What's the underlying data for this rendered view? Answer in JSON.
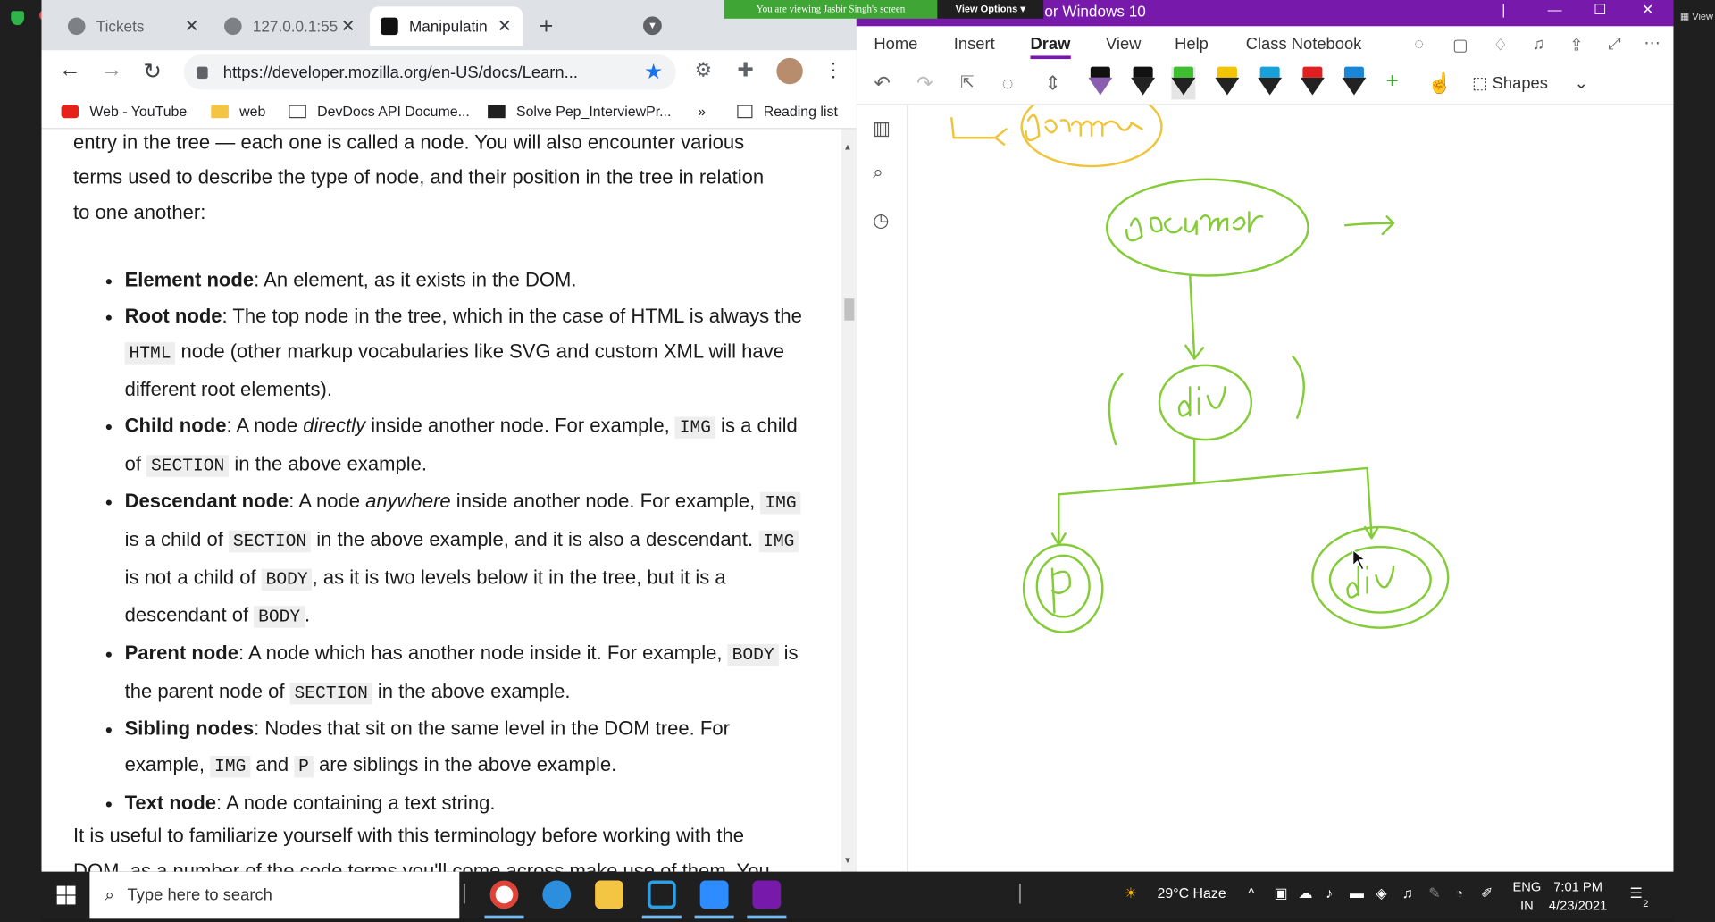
{
  "browser": {
    "tabs": [
      {
        "label": "Tickets"
      },
      {
        "label": "127.0.0.1:55"
      },
      {
        "label": "Manipulatin"
      }
    ],
    "url": "https://developer.mozilla.org/en-US/docs/Learn...",
    "bookmarks": [
      {
        "label": "Web - YouTube"
      },
      {
        "label": "web"
      },
      {
        "label": "DevDocs API Docume..."
      },
      {
        "label": "Solve Pep_InterviewPr..."
      }
    ],
    "bookmarks_overflow": "»",
    "reading_list": "Reading list"
  },
  "article": {
    "intro_lines": [
      "entry in the tree — each one is called a node. You will also encounter various",
      "terms used to describe the type of node, and their position in the tree in relation",
      "to one another:"
    ],
    "items": [
      {
        "term": "Element node",
        "rest": ": An element, as it exists in the DOM."
      },
      {
        "term": "Root node",
        "a": ": The top node in the tree, which in the case of HTML is always the ",
        "code1": "HTML",
        "b": " node (other markup vocabularies like SVG and custom XML will have different root elements)."
      },
      {
        "term": "Child node",
        "a": ": A node ",
        "em": "directly",
        "b": " inside another node. For example, ",
        "code1": "IMG",
        "c": " is a child of ",
        "code2": "SECTION",
        "d": " in the above example."
      },
      {
        "term": "Descendant node",
        "a": ": A node ",
        "em": "anywhere",
        "b": " inside another node. For example, ",
        "code1": "IMG",
        "c": " is a child of ",
        "code2": "SECTION",
        "d": " in the above example, and it is also a descendant. ",
        "code3": "IMG",
        "e": " is not a child of ",
        "code4": "BODY",
        "f": ", as it is two levels below it in the tree, but it is a descendant of ",
        "code5": "BODY",
        "g": "."
      },
      {
        "term": "Parent node",
        "a": ": A node which has another node inside it. For example, ",
        "code1": "BODY",
        "b": " is the parent node of ",
        "code2": "SECTION",
        "c": " in the above example."
      },
      {
        "term": "Sibling nodes",
        "a": ": Nodes that sit on the same level in the DOM tree. For example, ",
        "code1": "IMG",
        "b": " and ",
        "code2": "P",
        "c": " are siblings in the above example."
      },
      {
        "term": "Text node",
        "rest": ": A node containing a text string."
      }
    ],
    "outro_lines": [
      "It is useful to familiarize yourself with this terminology before working with the",
      "DOM, as a number of the code terms you'll come across make use of them. You"
    ]
  },
  "onenote": {
    "title": "or Windows 10",
    "menu": [
      "Home",
      "Insert",
      "Draw",
      "View",
      "Help",
      "Class Notebook"
    ],
    "active_menu": "Draw",
    "shapes_label": "Shapes",
    "pen_colors": [
      "#111111",
      "#111111",
      "#3fbf2f",
      "#f2c500",
      "#18a0d8",
      "#e02020",
      "#1a86d8"
    ],
    "ink_color": "#84cc37",
    "ink_color_top": "#f0c43a",
    "handwriting": {
      "root": "document",
      "child": "div",
      "left_leaf": "p",
      "right_leaf": "div",
      "top_partial": "docum"
    }
  },
  "zoom": {
    "banner": "You are viewing Jasbir Singh's screen",
    "view_options": "View Options",
    "right_label": "View"
  },
  "taskbar": {
    "search_placeholder": "Type here to search",
    "weather": "29°C  Haze",
    "lang_top": "ENG",
    "lang_bottom": "IN",
    "time": "7:01 PM",
    "date": "4/23/2021",
    "notification_count": "2"
  }
}
